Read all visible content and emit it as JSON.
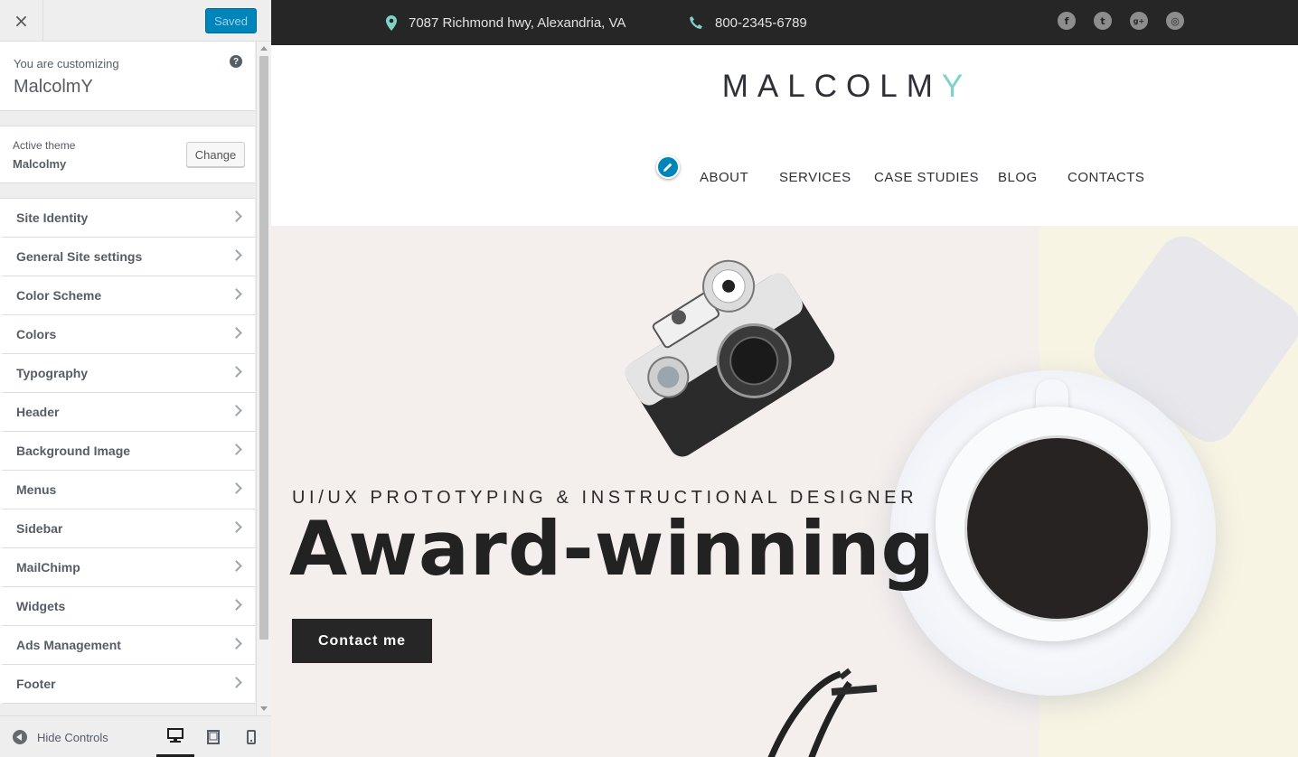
{
  "customizer": {
    "close_label": "×",
    "saved_label": "Saved",
    "customizing_label": "You are customizing",
    "site_name": "MalcolmY",
    "help_label": "?",
    "active_theme_label": "Active theme",
    "active_theme_name": "Malcolmy",
    "change_label": "Change",
    "panels": [
      {
        "label": "Site Identity"
      },
      {
        "label": "General Site settings"
      },
      {
        "label": "Color Scheme"
      },
      {
        "label": "Colors"
      },
      {
        "label": "Typography"
      },
      {
        "label": "Header"
      },
      {
        "label": "Background Image"
      },
      {
        "label": "Menus"
      },
      {
        "label": "Sidebar"
      },
      {
        "label": "MailChimp"
      },
      {
        "label": "Widgets"
      },
      {
        "label": "Ads Management"
      },
      {
        "label": "Footer"
      }
    ],
    "footer": {
      "hide_controls_label": "Hide Controls",
      "devices": [
        "desktop-icon",
        "tablet-icon",
        "mobile-icon"
      ],
      "active_device": "desktop"
    }
  },
  "preview": {
    "topbar": {
      "address": "7087 Richmond hwy, Alexandria, VA",
      "phone": "800-2345-6789",
      "social": [
        {
          "name": "facebook-icon",
          "glyph": "f"
        },
        {
          "name": "twitter-icon",
          "glyph": "t"
        },
        {
          "name": "google-plus-icon",
          "glyph": "g+"
        },
        {
          "name": "instagram-icon",
          "glyph": "◎"
        }
      ]
    },
    "logo": {
      "main": "MALCOLM",
      "accent": "Y",
      "accent_color": "#7ed2c8"
    },
    "nav": {
      "about": "ABOUT",
      "services": "SERVICES",
      "case_studies": "CASE STUDIES",
      "blog": "BLOG",
      "contacts": "CONTACTS"
    },
    "hero": {
      "subtitle": "UI/UX PROTOTYPING & INSTRUCTIONAL DESIGNER",
      "title": "Award-winning",
      "button": "Contact me"
    }
  },
  "colors": {
    "primary_blue": "#0085ba",
    "topbar_bg": "#262626",
    "accent_teal": "#7ed2c8"
  }
}
